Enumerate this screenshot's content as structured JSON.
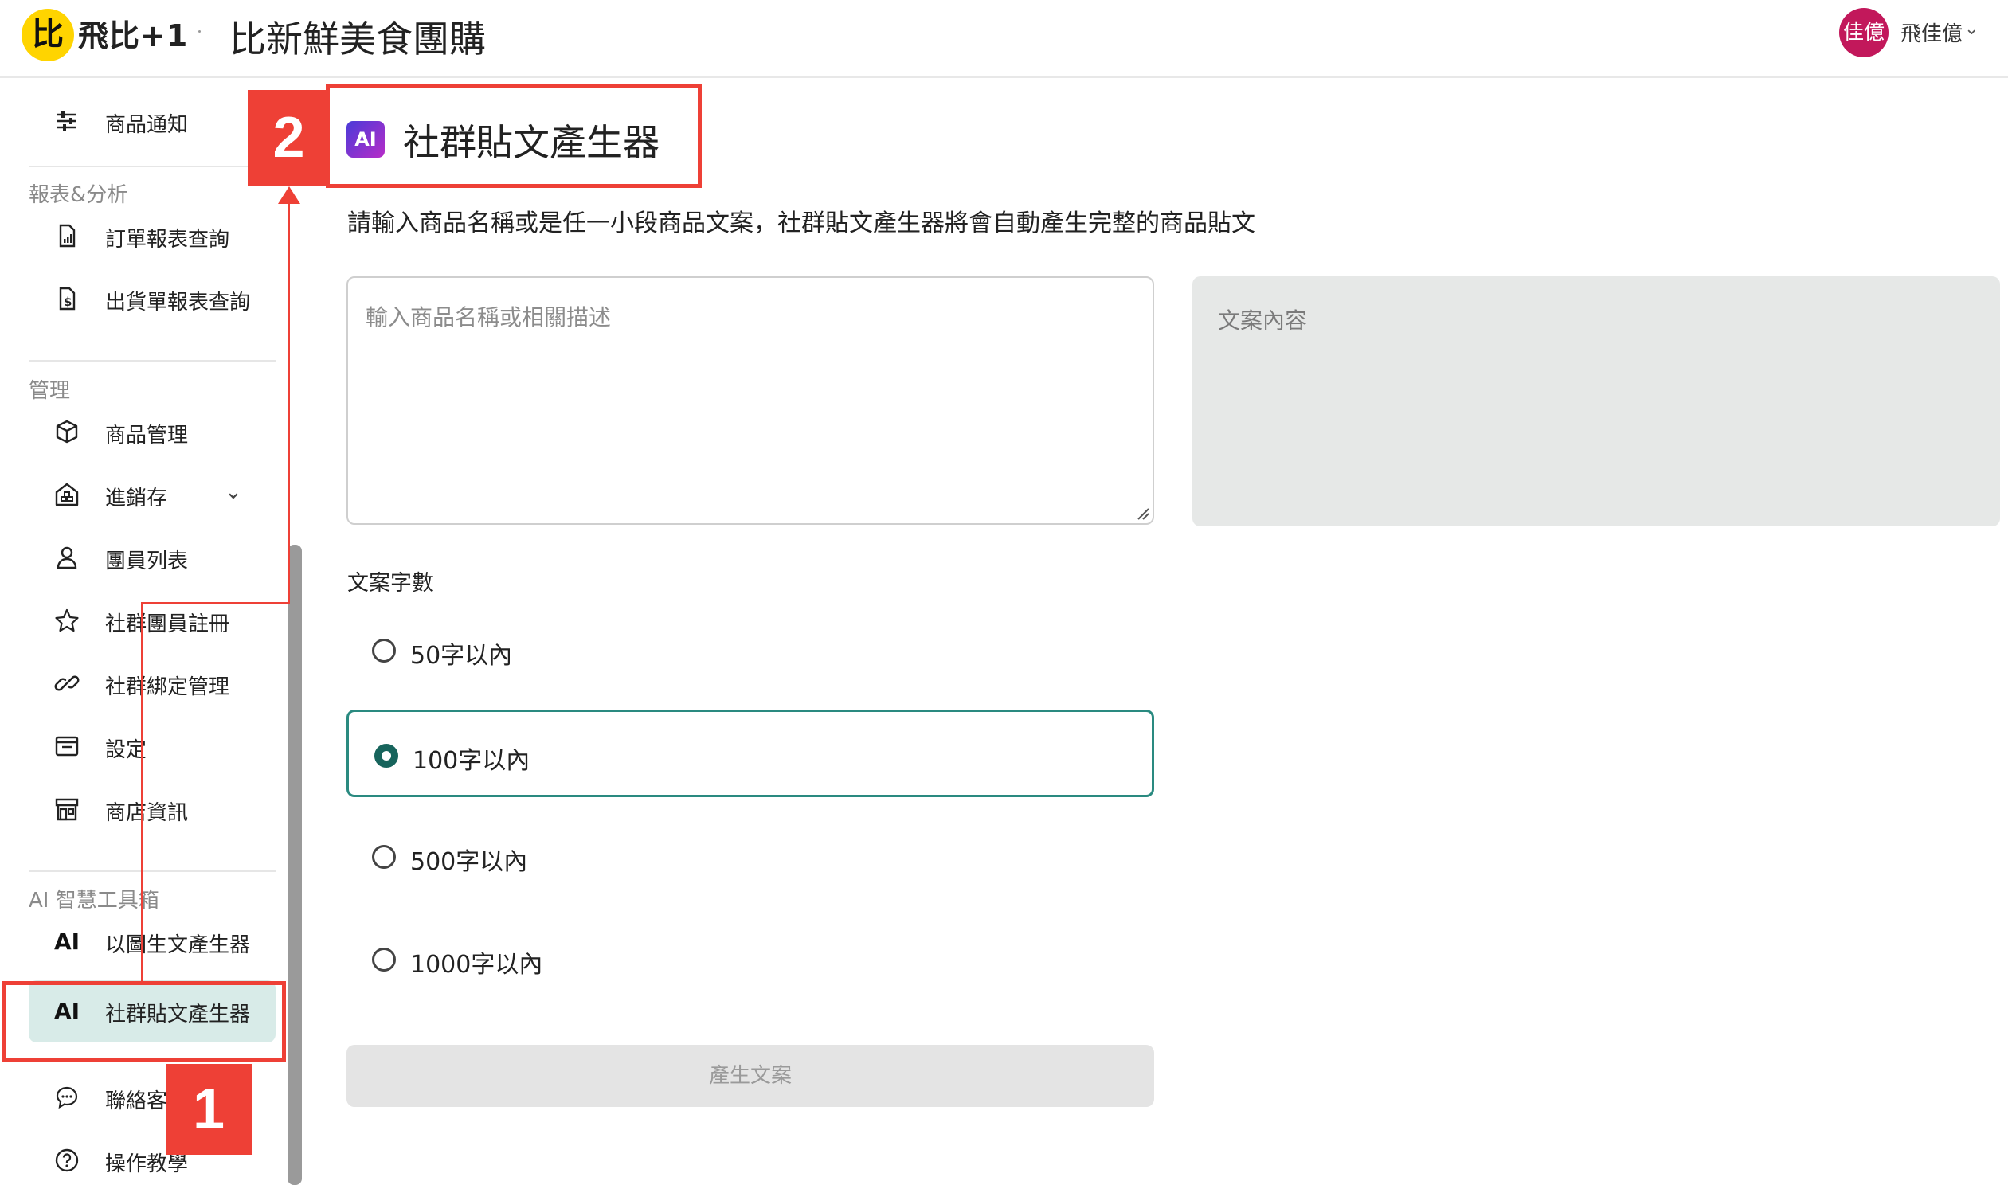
{
  "header": {
    "logo_mark": "比",
    "logo_text": "飛比+1",
    "shop_title": "比新鮮美食團購",
    "avatar_text": "佳億",
    "user_name": "飛佳億",
    "avatar_color": "#c2185b",
    "brand_color": "#ffd400"
  },
  "sidebar": {
    "top_item": {
      "label": "商品通知",
      "icon": "sliders-icon"
    },
    "sections": [
      {
        "title": "報表&分析",
        "items": [
          {
            "label": "訂單報表查詢",
            "icon": "report-file-icon"
          },
          {
            "label": "出貨單報表查詢",
            "icon": "invoice-file-icon"
          }
        ]
      },
      {
        "title": "管理",
        "items": [
          {
            "label": "商品管理",
            "icon": "box-icon"
          },
          {
            "label": "進銷存",
            "icon": "warehouse-icon",
            "expandable": true
          },
          {
            "label": "團員列表",
            "icon": "user-icon"
          },
          {
            "label": "社群團員註冊",
            "icon": "star-icon"
          },
          {
            "label": "社群綁定管理",
            "icon": "link-icon"
          },
          {
            "label": "設定",
            "icon": "settings-window-icon"
          },
          {
            "label": "商店資訊",
            "icon": "store-icon"
          }
        ]
      },
      {
        "title": "AI 智慧工具箱",
        "items": [
          {
            "label": "以圖生文產生器",
            "badge": "AI"
          },
          {
            "label": "社群貼文產生器",
            "badge": "AI",
            "active": true
          }
        ]
      }
    ],
    "bottom_items": [
      {
        "label": "聯絡客服",
        "icon": "chat-icon"
      },
      {
        "label": "操作教學",
        "icon": "help-icon"
      }
    ],
    "active_color": "#d8ebe8"
  },
  "main": {
    "ai_logo": "AI",
    "title": "社群貼文產生器",
    "description": "請輸入商品名稱或是任一小段商品文案，社群貼文產生器將會自動產生完整的商品貼文",
    "input": {
      "placeholder": "輸入商品名稱或相關描述",
      "value": ""
    },
    "output": {
      "label": "文案內容"
    },
    "word_count": {
      "label": "文案字數",
      "options": [
        "50字以內",
        "100字以內",
        "500字以內",
        "1000字以內"
      ],
      "selected_index": 1
    },
    "generate_button": "產生文案",
    "accent_color": "#2a8a80"
  },
  "annotations": {
    "step1": "1",
    "step2": "2",
    "color": "#ee4036"
  }
}
